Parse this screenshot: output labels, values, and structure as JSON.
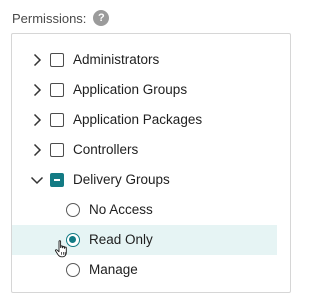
{
  "permissions": {
    "label": "Permissions:",
    "help_glyph": "?"
  },
  "tree": {
    "nodes": [
      {
        "label": "Administrators",
        "expanded": false,
        "checked": "unchecked"
      },
      {
        "label": "Application Groups",
        "expanded": false,
        "checked": "unchecked"
      },
      {
        "label": "Application Packages",
        "expanded": false,
        "checked": "unchecked"
      },
      {
        "label": "Controllers",
        "expanded": false,
        "checked": "unchecked"
      },
      {
        "label": "Delivery Groups",
        "expanded": true,
        "checked": "partial"
      }
    ],
    "delivery_group_options": [
      {
        "label": "No Access",
        "selected": false
      },
      {
        "label": "Read Only",
        "selected": true
      },
      {
        "label": "Manage",
        "selected": false
      }
    ]
  },
  "colors": {
    "accent": "#137b84",
    "highlight": "#e6f4f4",
    "border": "#d6d6d6",
    "help_icon": "#9b9b9b"
  },
  "icons": {
    "collapsed": "chevron-right-icon",
    "expanded": "chevron-down-icon",
    "help": "help-icon",
    "cursor": "hand-pointer-icon"
  }
}
